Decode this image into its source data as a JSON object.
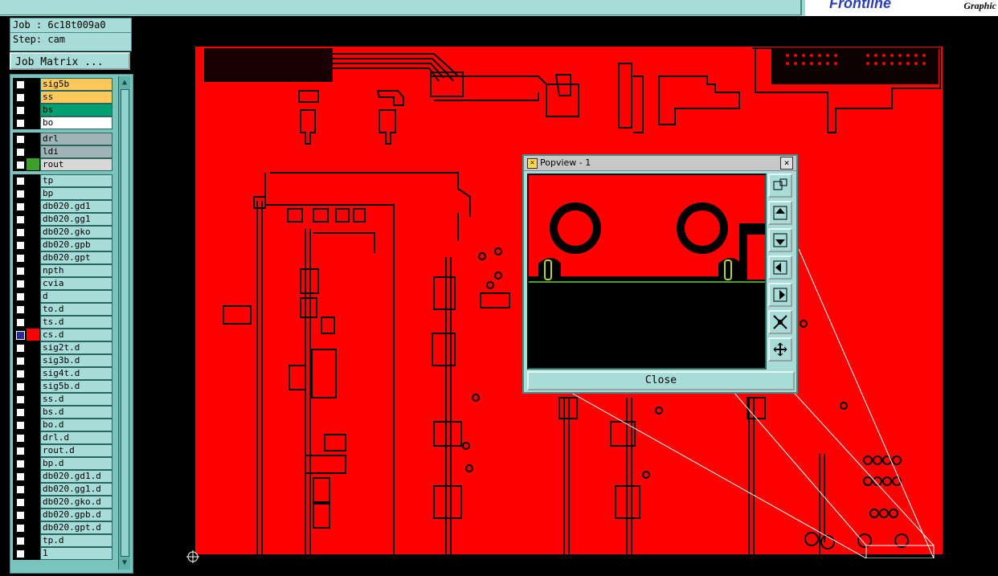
{
  "brand": {
    "logo": "Frontline",
    "sub": "Graphic"
  },
  "job": {
    "job_line": "Job : 6c18t009a0",
    "step_line": "Step: cam"
  },
  "job_matrix_label": "Job Matrix ...",
  "layers": [
    {
      "name": "sig5b",
      "color": "#ffc85a",
      "group": 1
    },
    {
      "name": "ss",
      "color": "#ffc85a",
      "group": 1
    },
    {
      "name": "bs",
      "color": "#00a070",
      "group": 1
    },
    {
      "name": "bo",
      "color": "#ffffff",
      "group": 1
    },
    {
      "name": "drl",
      "color": "#a0b4b8",
      "group": 2
    },
    {
      "name": "ldi",
      "color": "#a0b4b8",
      "group": 2
    },
    {
      "name": "rout",
      "color": "#d8d8d8",
      "group": 2,
      "swatch": "#3aa02a"
    },
    {
      "name": "tp",
      "color": "#a8dcd8",
      "group": 3
    },
    {
      "name": "bp",
      "color": "#a8dcd8",
      "group": 3
    },
    {
      "name": "db020.gd1",
      "color": "#a8dcd8",
      "group": 3
    },
    {
      "name": "db020.gg1",
      "color": "#a8dcd8",
      "group": 3
    },
    {
      "name": "db020.gko",
      "color": "#a8dcd8",
      "group": 3
    },
    {
      "name": "db020.gpb",
      "color": "#a8dcd8",
      "group": 3
    },
    {
      "name": "db020.gpt",
      "color": "#a8dcd8",
      "group": 3
    },
    {
      "name": "npth",
      "color": "#a8dcd8",
      "group": 3
    },
    {
      "name": "cvia",
      "color": "#a8dcd8",
      "group": 3
    },
    {
      "name": "d",
      "color": "#a8dcd8",
      "group": 3
    },
    {
      "name": "to.d",
      "color": "#a8dcd8",
      "group": 3
    },
    {
      "name": "ts.d",
      "color": "#a8dcd8",
      "group": 3
    },
    {
      "name": "cs.d",
      "color": "#a8dcd8",
      "group": 3,
      "swatch": "#ff0000",
      "active": true
    },
    {
      "name": "sig2t.d",
      "color": "#a8dcd8",
      "group": 3
    },
    {
      "name": "sig3b.d",
      "color": "#a8dcd8",
      "group": 3
    },
    {
      "name": "sig4t.d",
      "color": "#a8dcd8",
      "group": 3
    },
    {
      "name": "sig5b.d",
      "color": "#a8dcd8",
      "group": 3
    },
    {
      "name": "ss.d",
      "color": "#a8dcd8",
      "group": 3
    },
    {
      "name": "bs.d",
      "color": "#a8dcd8",
      "group": 3
    },
    {
      "name": "bo.d",
      "color": "#a8dcd8",
      "group": 3
    },
    {
      "name": "drl.d",
      "color": "#a8dcd8",
      "group": 3
    },
    {
      "name": "rout.d",
      "color": "#a8dcd8",
      "group": 3
    },
    {
      "name": "bp.d",
      "color": "#a8dcd8",
      "group": 3
    },
    {
      "name": "db020.gd1.d",
      "color": "#a8dcd8",
      "group": 3
    },
    {
      "name": "db020.gg1.d",
      "color": "#a8dcd8",
      "group": 3
    },
    {
      "name": "db020.gko.d",
      "color": "#a8dcd8",
      "group": 3
    },
    {
      "name": "db020.gpb.d",
      "color": "#a8dcd8",
      "group": 3
    },
    {
      "name": "db020.gpt.d",
      "color": "#a8dcd8",
      "group": 3
    },
    {
      "name": "tp.d",
      "color": "#a8dcd8",
      "group": 3
    },
    {
      "name": "1",
      "color": "#a8dcd8",
      "group": 3
    }
  ],
  "popview": {
    "title": "Popview - 1",
    "close_label": "Close",
    "tools": [
      "zoom-fit-icon",
      "pan-up-icon",
      "pan-down-icon",
      "pan-left-icon",
      "pan-right-icon",
      "zoom-in-icon",
      "zoom-out-icon"
    ]
  },
  "colors": {
    "board": "#ff0000",
    "ui": "#a8dcd8",
    "trace_outline": "#000000"
  }
}
